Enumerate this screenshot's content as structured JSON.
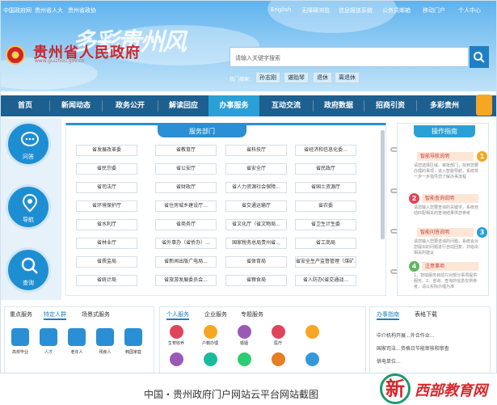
{
  "topbar": {
    "links": [
      "中国政府网",
      "贵州省人大",
      "贵州省政协"
    ],
    "right": [
      "English",
      "无障碍浏览",
      "信息报送系统",
      "公务员邮箱",
      "移动门户",
      "个人中心"
    ]
  },
  "header": {
    "site_name": "贵州省人民政府",
    "site_url": "www.guizhou.gov.cn",
    "brush_title": "多彩贵州风",
    "search_placeholder": "请输入关键字搜索",
    "hot_label": "热门搜索：",
    "hot_tags": [
      "孙志刚",
      "谌贻琴",
      "退休",
      "离退休"
    ]
  },
  "nav": {
    "items": [
      "首页",
      "新闻动态",
      "政务公开",
      "解读回应",
      "办事服务",
      "互动交流",
      "政府数据",
      "招商引资",
      "多彩贵州"
    ],
    "active": "办事服务"
  },
  "left": {
    "circles": [
      "问答",
      "导航",
      "查询"
    ]
  },
  "departments": {
    "title": "服务部门",
    "items": [
      "省发展改革委",
      "省教育厅",
      "省科技厅",
      "省经济和信息化委...",
      "省民宗委",
      "省公安厅",
      "省安全厅",
      "省民政厅",
      "省司法厅",
      "省财政厅",
      "省人力资源社会保障...",
      "省国土资源厅",
      "省环境保护厅",
      "省住房城乡建设厅...",
      "省交通运输厅",
      "省农委",
      "省水利厅",
      "省商务厅",
      "省文化厅（省文物局...",
      "省卫生计生委",
      "省林业厅",
      "省外事办（省侨办）...",
      "国家税务总局贵州省...",
      "省工商局",
      "省质监局",
      "省新闻出版广电局...",
      "省体育局",
      "省安全生产监督管理（煤矿...",
      "省统计局",
      "省旅游发展委员会...",
      "省粮食局",
      "省人防办(省交通战..."
    ]
  },
  "guide": {
    "title": "操作指南",
    "steps": [
      {
        "num": "1",
        "label": "智能导航说明",
        "text": "请您选择区域、审批部门，找到您要办理的事项，进入智能导航，系统将一步一步指导您了解办事流程"
      },
      {
        "num": "2",
        "label": "智能查询说明",
        "text": "请您输入您要查询的关键字，系统自动匹配相关的查询结果供您参考"
      },
      {
        "num": "3",
        "label": "智能问答说明",
        "text": "请您输入您要咨询的问题，系统会对您提出的问题进行自动回复，并给出相关的建议"
      },
      {
        "num": "4",
        "label": "注意事项",
        "text": "1、智能服务目前只对部分事项提供服务。2、咨询、查询的信息仅供参考，请以实际办理为准"
      }
    ],
    "colors": [
      "#f5a623",
      "#e0445a",
      "#2aa0d6",
      "#5cb85c"
    ]
  },
  "bottom_left": {
    "tabs": [
      "重点服务",
      "特定人群",
      "场景式服务"
    ],
    "active": "特定人群",
    "icons": [
      {
        "label": "高校毕业",
        "color": "#2a8fd4"
      },
      {
        "label": "人才",
        "color": "#2a8fd4"
      },
      {
        "label": "老年人",
        "color": "#2a8fd4"
      },
      {
        "label": "残疾人",
        "color": "#2a8fd4"
      },
      {
        "label": "韩国家庭",
        "color": "#2a8fd4"
      }
    ]
  },
  "bottom_mid": {
    "tabs": [
      "个人服务",
      "企业服务",
      "专题服务"
    ],
    "active": "个人服务",
    "icons": [
      {
        "label": "生育收养",
        "color": "#e0445a"
      },
      {
        "label": "户籍办理",
        "color": "#f5a623"
      },
      {
        "label": "婚姻",
        "color": "#9b59b6"
      },
      {
        "label": "医疗",
        "color": "#e0445a"
      },
      {
        "label": "",
        "color": "#f5a623"
      },
      {
        "label": "",
        "color": "#9b59b6"
      },
      {
        "label": "",
        "color": "#1abc9c"
      },
      {
        "label": "",
        "color": "#2ecc71"
      },
      {
        "label": "",
        "color": "#e67e22"
      },
      {
        "label": "",
        "color": "#3498db"
      }
    ]
  },
  "bottom_right": {
    "tabs": [
      "办事指南",
      "表格下载"
    ],
    "active": "办事指南",
    "lines": [
      "中介机构开展...外合作业...",
      "国家司法...资格日节能审核和审查",
      "供电单位..."
    ]
  },
  "caption": {
    "text": "中国・贵州政府门户网站云平台网站截图"
  },
  "watermark": {
    "char": "新",
    "text": "西部教育网"
  }
}
